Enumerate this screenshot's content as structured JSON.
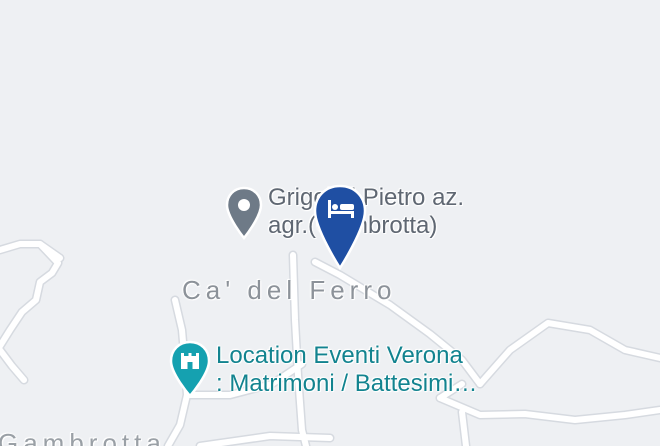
{
  "map": {
    "colors": {
      "background": "#eef0f3",
      "road_fill": "#ffffff",
      "road_casing": "#d6dae0",
      "generic_pin": "#6e7a87",
      "hotel_pin": "#1f4fa3",
      "venue_pin": "#15a1b0"
    },
    "labels": {
      "poi_generic": {
        "line1": "Grigolini Pietro az.",
        "line2": "agr.(Gambrotta)",
        "icon": "location-pin-icon"
      },
      "place_locality": "Ca' del Ferro",
      "poi_venue": {
        "line1": "Location Eventi Verona",
        "line2": ": Matrimoni / Battesimi…",
        "icon": "castle-venue-icon"
      },
      "place_bottom": "Gambrotta"
    },
    "markers": {
      "hotel": {
        "icon": "hotel-bed-icon"
      }
    }
  }
}
